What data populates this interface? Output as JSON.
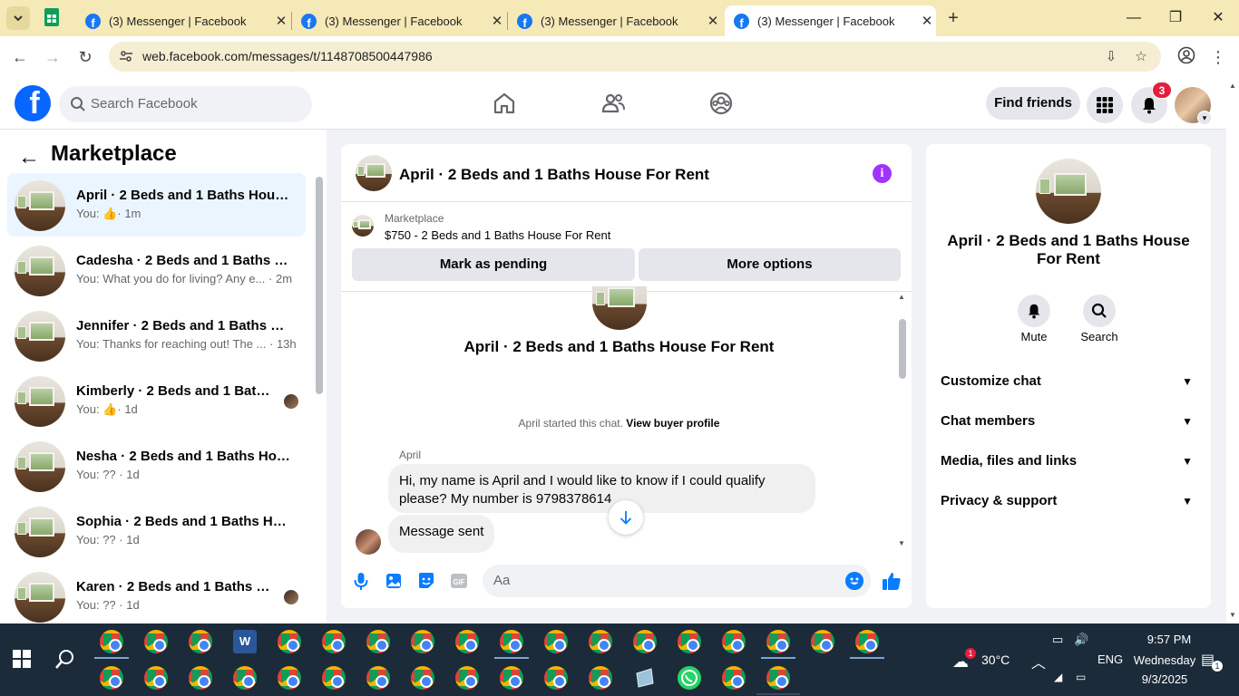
{
  "browser": {
    "tabs": [
      {
        "title": "(3) Messenger | Facebook"
      },
      {
        "title": "(3) Messenger | Facebook"
      },
      {
        "title": "(3) Messenger | Facebook"
      },
      {
        "title": "(3) Messenger | Facebook",
        "active": true
      }
    ],
    "url": "web.facebook.com/messages/t/1148708500447986"
  },
  "fb": {
    "search_placeholder": "Search Facebook",
    "find_friends": "Find friends",
    "notification_count": "3"
  },
  "sidebar": {
    "title": "Marketplace",
    "conversations": [
      {
        "name": "April · 2 Beds and 1 Baths House...",
        "prefix": "You:",
        "preview": "",
        "time": "· 1m",
        "like": true,
        "selected": true
      },
      {
        "name": "Cadesha · 2 Beds and 1 Baths Ho...",
        "prefix": "You:",
        "preview": "What you do for living? Any e...",
        "time": "· 2m"
      },
      {
        "name": "Jennifer · 2 Beds and 1 Baths Ho...",
        "prefix": "You:",
        "preview": "Thanks for reaching out! The ...",
        "time": "· 13h"
      },
      {
        "name": "Kimberly · 2 Beds and 1 Baths ...",
        "prefix": "You:",
        "preview": "",
        "time": "· 1d",
        "like": true,
        "avatar": true
      },
      {
        "name": "Nesha · 2 Beds and 1 Baths Hous...",
        "prefix": "You:",
        "preview": "??",
        "time": "· 1d"
      },
      {
        "name": "Sophia · 2 Beds and 1 Baths Hou...",
        "prefix": "You:",
        "preview": "??",
        "time": "· 1d"
      },
      {
        "name": "Karen · 2 Beds and 1 Baths Ho...",
        "prefix": "You:",
        "preview": "??",
        "time": "· 1d",
        "avatar": true
      }
    ]
  },
  "chat": {
    "title": "April · 2 Beds and 1 Baths House For Rent",
    "marketplace_label": "Marketplace",
    "listing": "$750 - 2 Beds and 1 Baths House For Rent",
    "mark_pending": "Mark as pending",
    "more_options": "More options",
    "center_title": "April · 2 Beds and 1 Baths House For Rent",
    "started_text": "April started this chat.",
    "view_buyer": "View buyer profile",
    "sender": "April",
    "message1": "Hi, my name is April and I would like to know if I could qualify please? My number is 9798378614",
    "message2": "Message sent",
    "composer_placeholder": "Aa"
  },
  "info_panel": {
    "title": "April · 2 Beds and 1 Baths House For Rent",
    "mute": "Mute",
    "search": "Search",
    "sections": [
      "Customize chat",
      "Chat members",
      "Media, files and links",
      "Privacy & support"
    ]
  },
  "taskbar": {
    "temperature": "30°C",
    "language": "ENG",
    "time": "9:57 PM",
    "day": "Wednesday",
    "date": "9/3/2025",
    "weather_badge": "1",
    "notif_badge": "1"
  },
  "colors": {
    "fb_blue": "#0866ff",
    "messenger_blue": "#0a7cff",
    "selected_row": "#ebf5ff",
    "info_purple": "#a033ff",
    "chrome_tabstrip": "#f5e9b8"
  }
}
